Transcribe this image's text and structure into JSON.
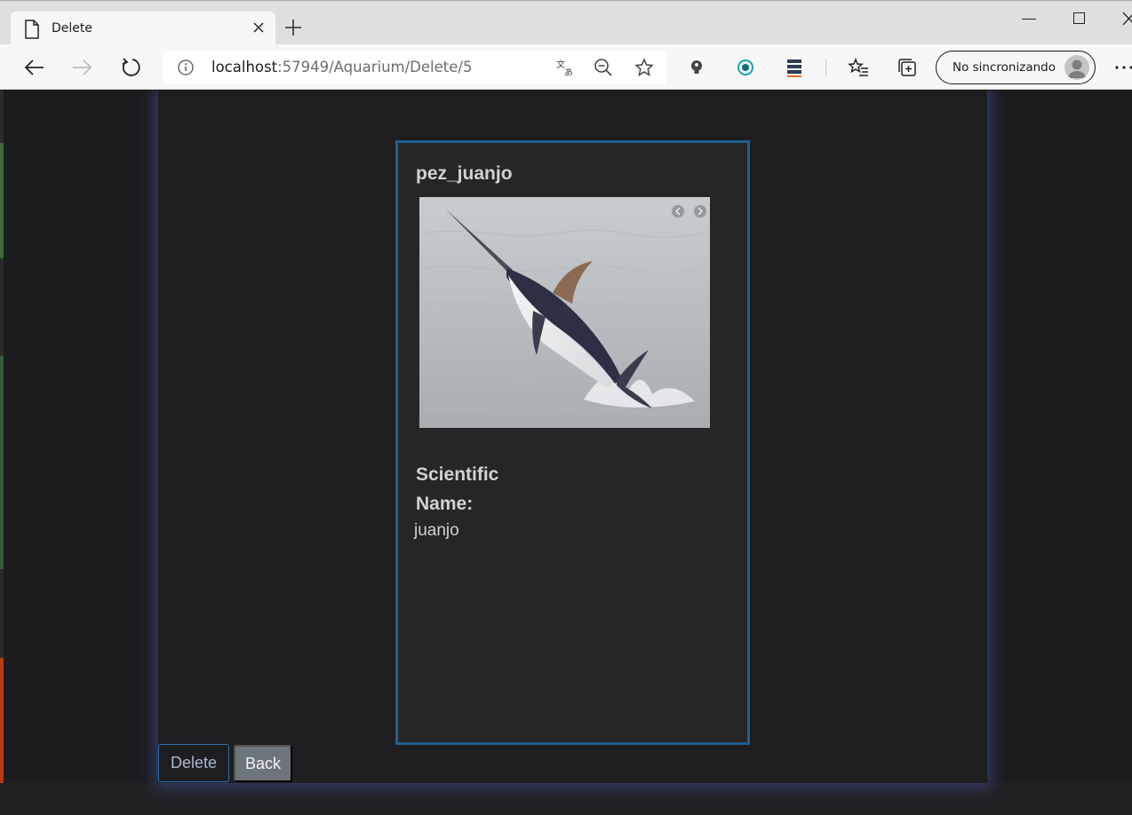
{
  "browser": {
    "tab_title": "Delete",
    "url_host": "localhost",
    "url_path": ":57949/Aquarium/Delete/5",
    "sync_label": "No sincronizando"
  },
  "page": {
    "card_title": "pez_juanjo",
    "field_label": "Scientific Name:",
    "field_value": "juanjo",
    "delete_label": "Delete",
    "back_label": "Back"
  },
  "colors": {
    "accent_blue": "#1f5f95",
    "panel_glow": "#4862be",
    "back_button": "#6c747c"
  },
  "icons": [
    "page-icon",
    "close-icon",
    "plus-icon",
    "back-arrow-icon",
    "forward-arrow-icon",
    "refresh-icon",
    "info-icon",
    "translate-icon",
    "zoom-out-icon",
    "favorite-star-icon",
    "lightbulb-extension-icon",
    "target-extension-icon",
    "stack-extension-icon",
    "favorites-list-icon",
    "collections-icon",
    "profile-avatar-icon",
    "more-options-icon",
    "carousel-prev-icon",
    "carousel-next-icon"
  ]
}
